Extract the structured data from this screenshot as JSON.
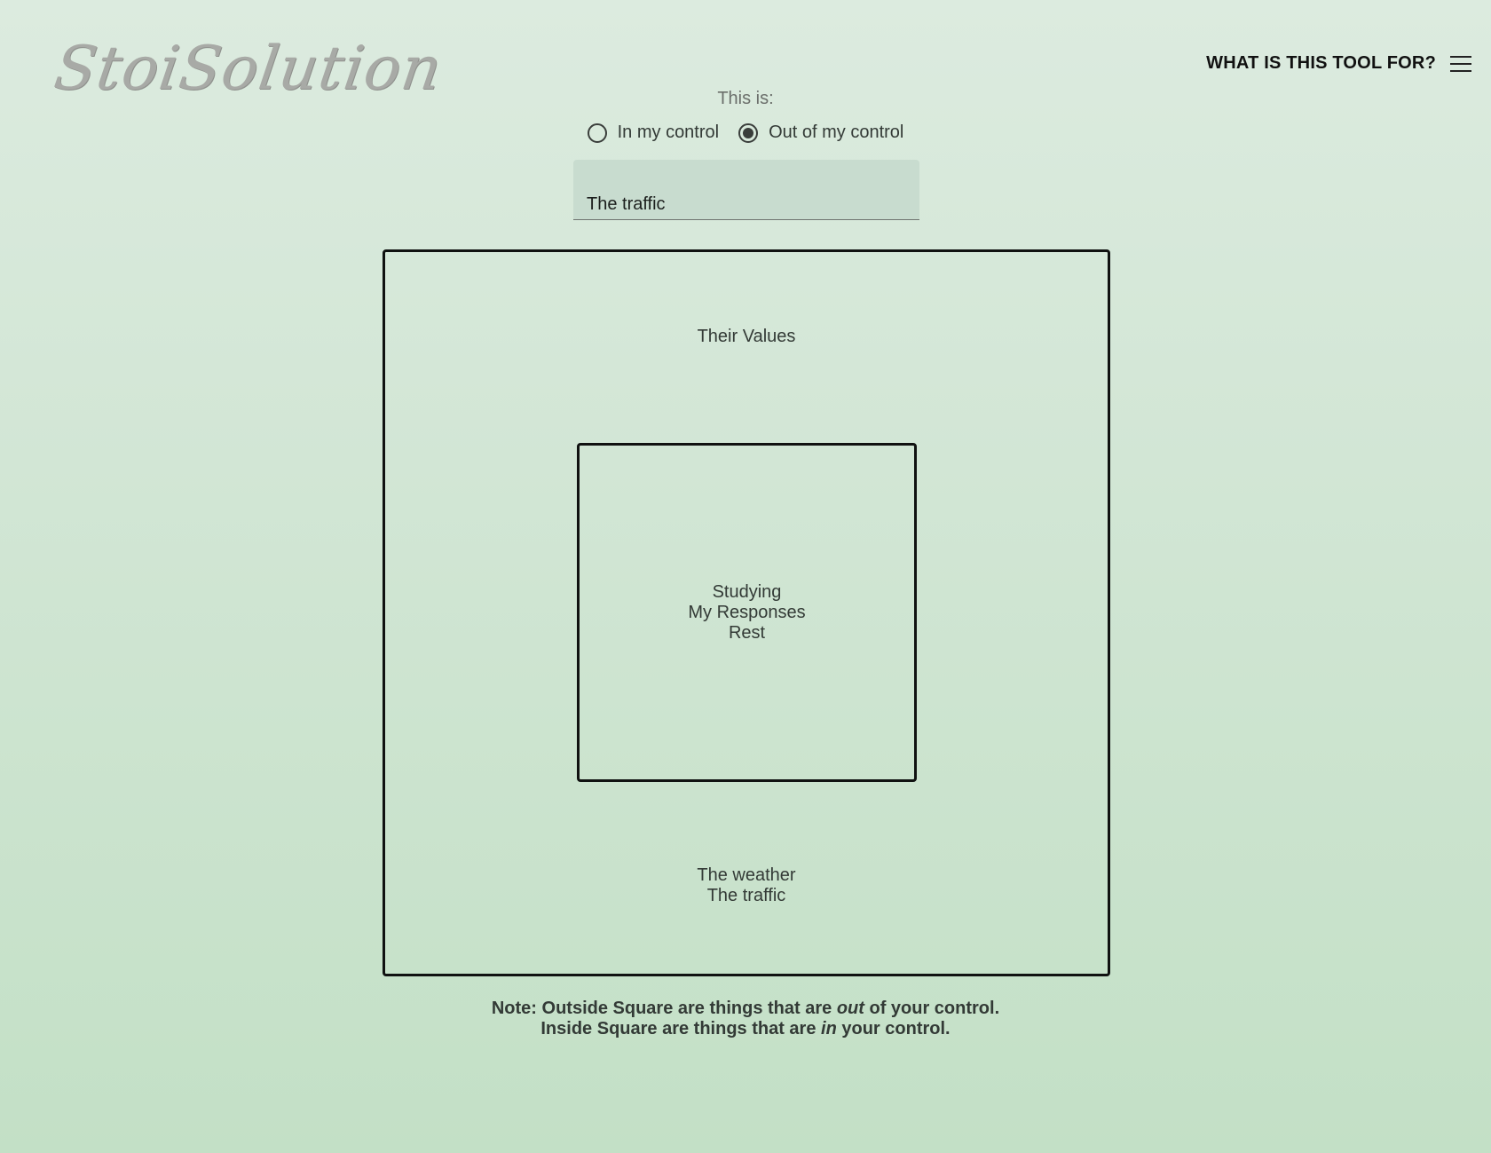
{
  "header": {
    "logo_text": "StoiSolution",
    "nav_link": "WHAT IS THIS TOOL FOR?",
    "menu_icon": "hamburger-menu-icon"
  },
  "form": {
    "prompt_label": "This is:",
    "options": [
      {
        "label": "In my control",
        "selected": false
      },
      {
        "label": "Out of my control",
        "selected": true
      }
    ],
    "input_value": "The traffic"
  },
  "squares": {
    "outer_items_top": [
      "Their Values"
    ],
    "inner_items": [
      "Studying",
      "My Responses",
      "Rest"
    ],
    "outer_items_bottom": [
      "The weather",
      "The traffic"
    ]
  },
  "note": {
    "line1_prefix": "Note: Outside Square are things that are ",
    "line1_emphasis": "out",
    "line1_suffix": " of your control.",
    "line2_prefix": "Inside Square are things that are ",
    "line2_emphasis": "in",
    "line2_suffix": " your control."
  }
}
